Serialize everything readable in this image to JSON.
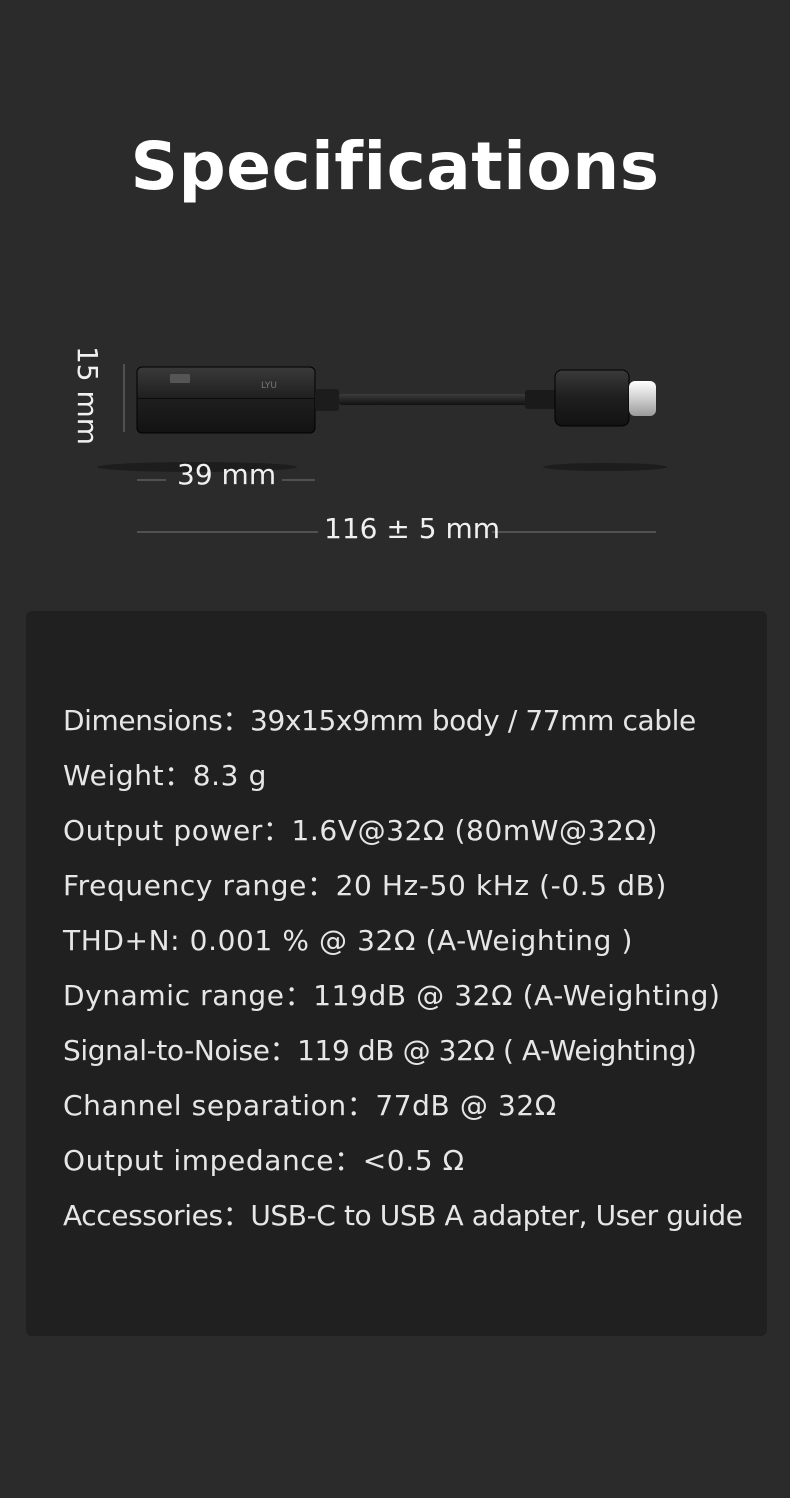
{
  "title": "Specifications",
  "diagram": {
    "height_label": "15 mm",
    "body_length_value": "39",
    "body_length_unit": "mm",
    "total_length_value": "116 ± 5",
    "total_length_unit": "mm",
    "colors": {
      "background": "#2b2b2b",
      "panel": "#202020",
      "line": "#777777"
    }
  },
  "specs": [
    {
      "label": "Dimensions",
      "sep": "：",
      "value": "39x15x9mm body / 77mm cable"
    },
    {
      "label": "Weight",
      "sep": "：",
      "value": "8.3 g"
    },
    {
      "label": "Output power",
      "sep": "：",
      "value": "1.6V@32Ω (80mW@32Ω)"
    },
    {
      "label": "Frequency range",
      "sep": "：",
      "value": "20 Hz-50 kHz (-0.5 dB)"
    },
    {
      "label": "THD+N",
      "sep": ": ",
      "value": "0.001 % @ 32Ω (A-Weighting )"
    },
    {
      "label": "Dynamic range",
      "sep": "：",
      "value": "119dB @ 32Ω (A-Weighting)"
    },
    {
      "label": "Signal-to-Noise",
      "sep": "：",
      "value": "119 dB @ 32Ω ( A-Weighting)"
    },
    {
      "label": "Channel separation",
      "sep": "：",
      "value": "77dB @ 32Ω"
    },
    {
      "label": "Output impedance",
      "sep": "：",
      "value": "<0.5 Ω"
    },
    {
      "label": "Accessories",
      "sep": "：",
      "value": "USB-C to USB A adapter, User guide"
    }
  ]
}
